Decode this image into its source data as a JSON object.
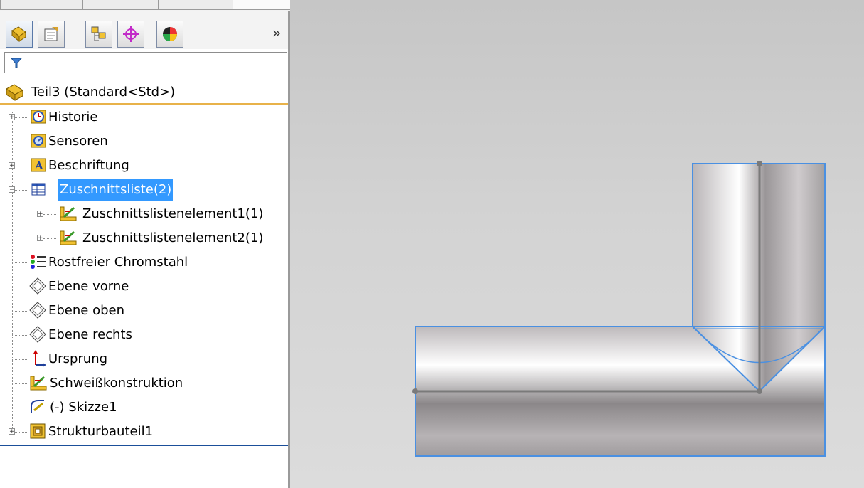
{
  "feature_manager": {
    "toolbar_tabs": [
      {
        "name": "featuremanager-tab",
        "icon": "featuremanager-icon"
      },
      {
        "name": "propertymanager-tab",
        "icon": "propertymanager-icon"
      },
      {
        "name": "configurationmanager-tab",
        "icon": "configurationmanager-icon"
      },
      {
        "name": "dimxpert-tab",
        "icon": "dimxpert-icon"
      },
      {
        "name": "displaymanager-tab",
        "icon": "displaymanager-icon"
      }
    ],
    "more_label": "»",
    "root": {
      "label": "Teil3  (Standard<Std>)"
    },
    "items": [
      {
        "label": "Historie"
      },
      {
        "label": "Sensoren"
      },
      {
        "label": "Beschriftung"
      },
      {
        "label": "Zuschnittsliste(2)"
      },
      {
        "label": "Zuschnittslistenelement1(1)"
      },
      {
        "label": "Zuschnittslistenelement2(1)"
      },
      {
        "label": "Rostfreier Chromstahl"
      },
      {
        "label": "Ebene vorne"
      },
      {
        "label": "Ebene oben"
      },
      {
        "label": "Ebene rechts"
      },
      {
        "label": "Ursprung"
      },
      {
        "label": "Schweißkonstruktion"
      },
      {
        "label": "(-) Skizze1"
      },
      {
        "label": "Strukturbauteil1"
      }
    ]
  },
  "colors": {
    "selection": "#3399ff",
    "edge_highlight": "#4a90e2",
    "panel_accent": "#e8b24a",
    "panel_bottom_line": "#1b4f9a"
  }
}
